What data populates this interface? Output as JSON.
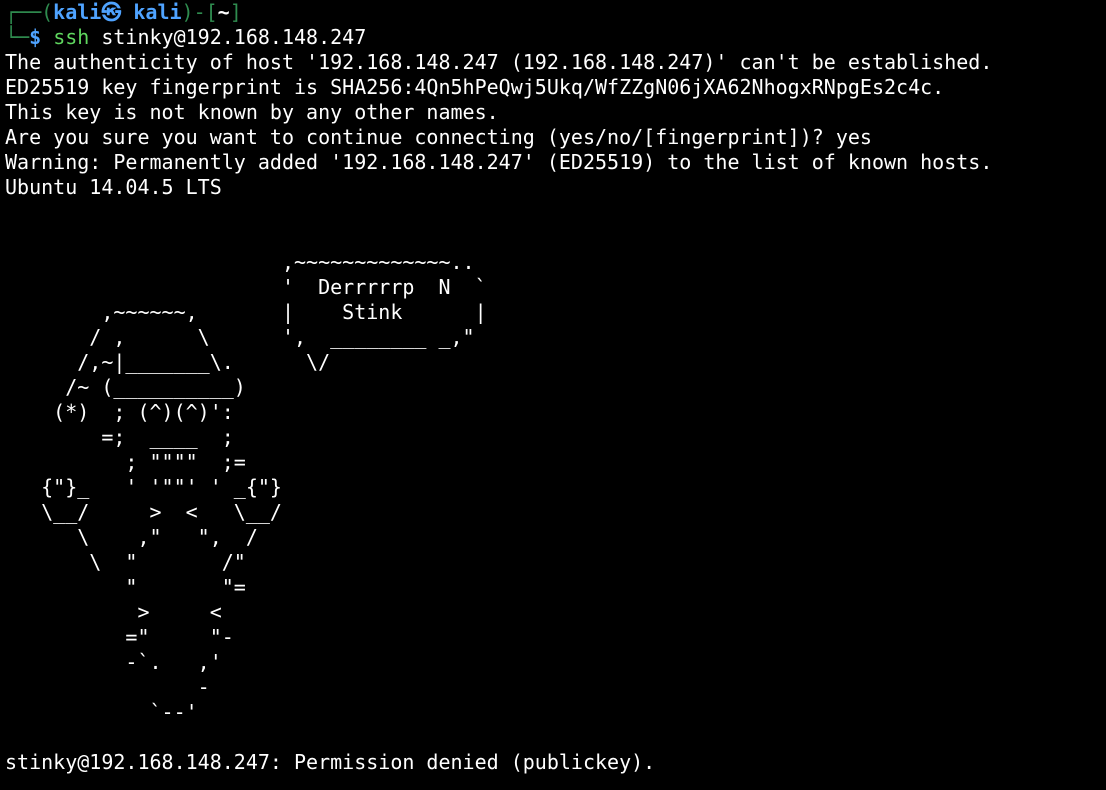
{
  "prompt": {
    "frame_left": "┌──(",
    "user_host": "kali㉿ kali",
    "frame_mid": ")-[",
    "dir": "~",
    "frame_right": "]",
    "frame_bottom": "└─",
    "dollar": "$ ",
    "command": "ssh",
    "args": " stinky@192.168.148.247"
  },
  "output_lines": [
    "The authenticity of host '192.168.148.247 (192.168.148.247)' can't be established.",
    "ED25519 key fingerprint is SHA256:4Qn5hPeQwj5Ukq/WfZZgN06jXA62NhogxRNpgEs2c4c.",
    "This key is not known by any other names.",
    "Are you sure you want to continue connecting (yes/no/[fingerprint])? yes",
    "Warning: Permanently added '192.168.148.247' (ED25519) to the list of known hosts.",
    "Ubuntu 14.04.5 LTS",
    "",
    "",
    "                       ,~~~~~~~~~~~~~..",
    "                       '  Derrrrrp  N  `",
    "        ,~~~~~~,       |    Stink      |",
    "       / ,      \\      ',  ________ _,\"",
    "      /,~|_______\\.      \\/",
    "     /~ (__________)",
    "    (*)  ; (^)(^)':",
    "        =;  ____  ;",
    "          ; \"\"\"\"  ;=",
    "   {\"}_   ' '\"\"' ' _{\"}",
    "   \\__/     >  <   \\__/",
    "      \\    ,\"   \",  /",
    "       \\  \"       /\"",
    "          \"       \"=",
    "           >     <",
    "          =\"     \"-",
    "          -`.   ,'",
    "                -",
    "            `--'",
    "",
    "stinky@192.168.148.247: Permission denied (publickey)."
  ]
}
